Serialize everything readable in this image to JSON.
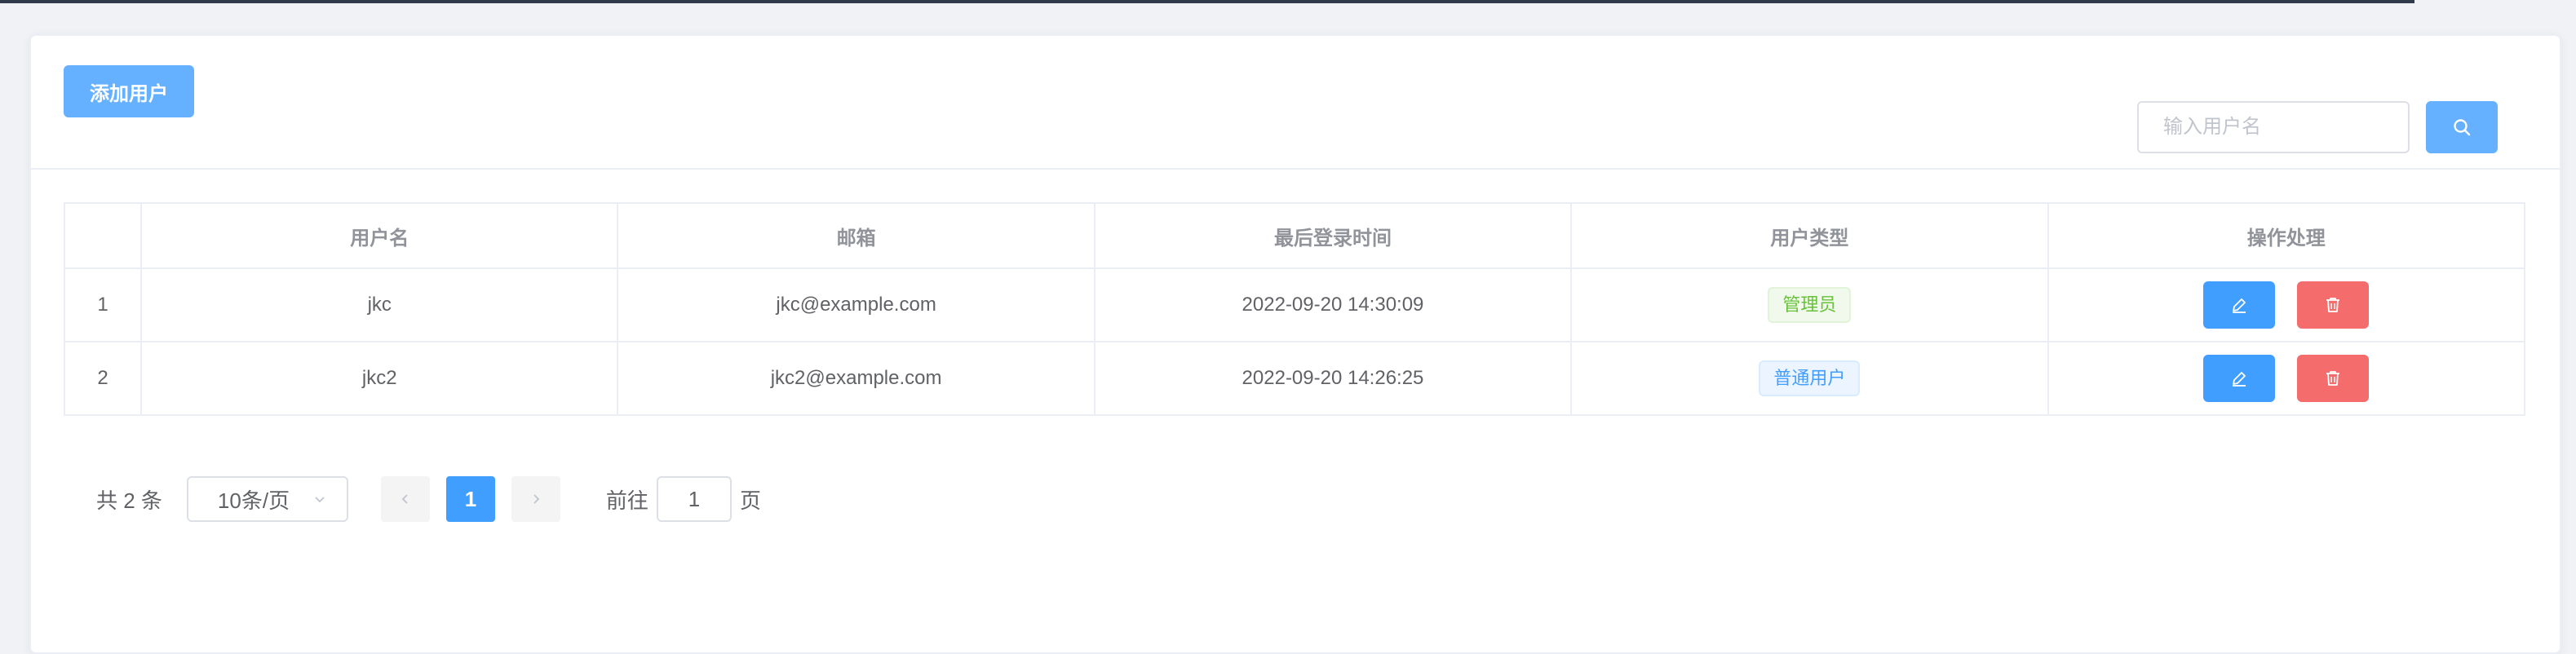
{
  "toolbar": {
    "add_label": "添加用户"
  },
  "search": {
    "placeholder": "输入用户名",
    "value": ""
  },
  "table": {
    "headers": [
      "",
      "用户名",
      "邮箱",
      "最后登录时间",
      "用户类型",
      "操作处理"
    ],
    "rows": [
      {
        "index": "1",
        "username": "jkc",
        "email": "jkc@example.com",
        "last_login": "2022-09-20 14:30:09",
        "type": "管理员",
        "type_kind": "admin"
      },
      {
        "index": "2",
        "username": "jkc2",
        "email": "jkc2@example.com",
        "last_login": "2022-09-20 14:26:25",
        "type": "普通用户",
        "type_kind": "user"
      }
    ]
  },
  "pagination": {
    "total_text": "共 2 条",
    "page_size": "10条/页",
    "current_page": "1",
    "goto_label": "前往",
    "goto_value": "1",
    "page_suffix": "页"
  },
  "colors": {
    "primary": "#409eff",
    "danger": "#f56c6c",
    "success": "#67c23a"
  },
  "icons": {
    "search": "search-icon",
    "edit": "edit-icon",
    "delete": "trash-icon",
    "prev": "chevron-left-icon",
    "next": "chevron-right-icon",
    "dropdown": "chevron-down-icon"
  }
}
